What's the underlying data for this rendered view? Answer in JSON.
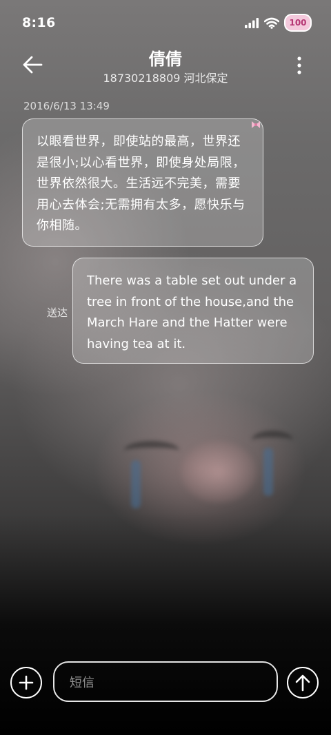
{
  "status_bar": {
    "time": "8:16",
    "battery_level": "100",
    "icons": [
      "signal-icon",
      "wifi-icon",
      "battery-icon"
    ]
  },
  "header": {
    "contact_name": "倩倩",
    "contact_info": "18730218809 河北保定",
    "back_icon": "arrow-left-icon",
    "more_icon": "more-vertical-icon"
  },
  "conversation": {
    "timestamp": "2016/6/13 13:49",
    "messages": [
      {
        "direction": "incoming",
        "text": "以眼看世界，即使站的最高，世界还是很小;以心看世界，即使身处局限，世界依然很大。生活远不完美，需要用心去体会;无需拥有太多，愿快乐与你相随。"
      },
      {
        "direction": "outgoing",
        "text": "There was a table set out under a tree in front of the house,and the March Hare and the Hatter were having tea at it.",
        "status": "送达"
      }
    ]
  },
  "composer": {
    "placeholder": "短信",
    "add_icon": "plus-icon",
    "send_icon": "arrow-up-icon"
  },
  "colors": {
    "battery_fill": "#f4c9dc",
    "battery_text": "#b53673",
    "bubble_border": "#ffffff"
  }
}
